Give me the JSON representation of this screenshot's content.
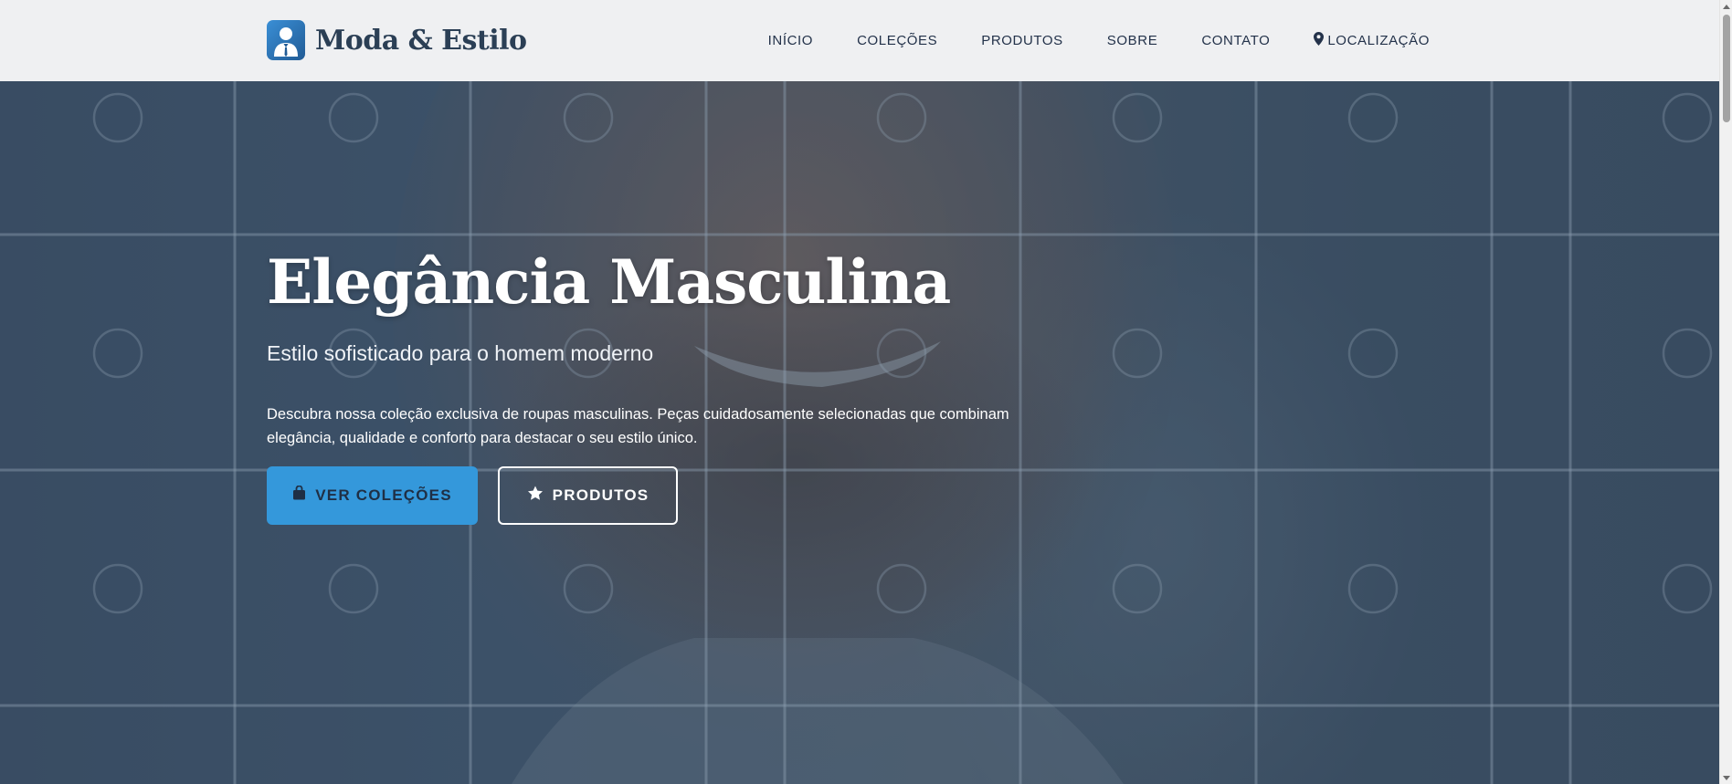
{
  "brand": {
    "name": "Moda & Estilo",
    "logo_icon": "person-suit-icon"
  },
  "nav": {
    "items": [
      {
        "label": "INÍCIO"
      },
      {
        "label": "COLEÇÕES"
      },
      {
        "label": "PRODUTOS"
      },
      {
        "label": "SOBRE"
      },
      {
        "label": "CONTATO"
      },
      {
        "label": "LOCALIZAÇÃO",
        "icon": "map-pin-icon"
      }
    ]
  },
  "hero": {
    "title": "Elegância Masculina",
    "subtitle": "Estilo sofisticado para o homem moderno",
    "description": "Descubra nossa coleção exclusiva de roupas masculinas. Peças cuidadosamente selecionadas que combinam elegância, qualidade e conforto para destacar o seu estilo único.",
    "primary_button": {
      "label": "VER COLEÇÕES",
      "icon": "shopping-bag-icon"
    },
    "secondary_button": {
      "label": "PRODUTOS",
      "icon": "star-icon"
    }
  },
  "colors": {
    "accent": "#3498db",
    "header_bg": "#eff0f2",
    "brand_text": "#2b3f55",
    "hero_overlay": "#3d4f63"
  }
}
